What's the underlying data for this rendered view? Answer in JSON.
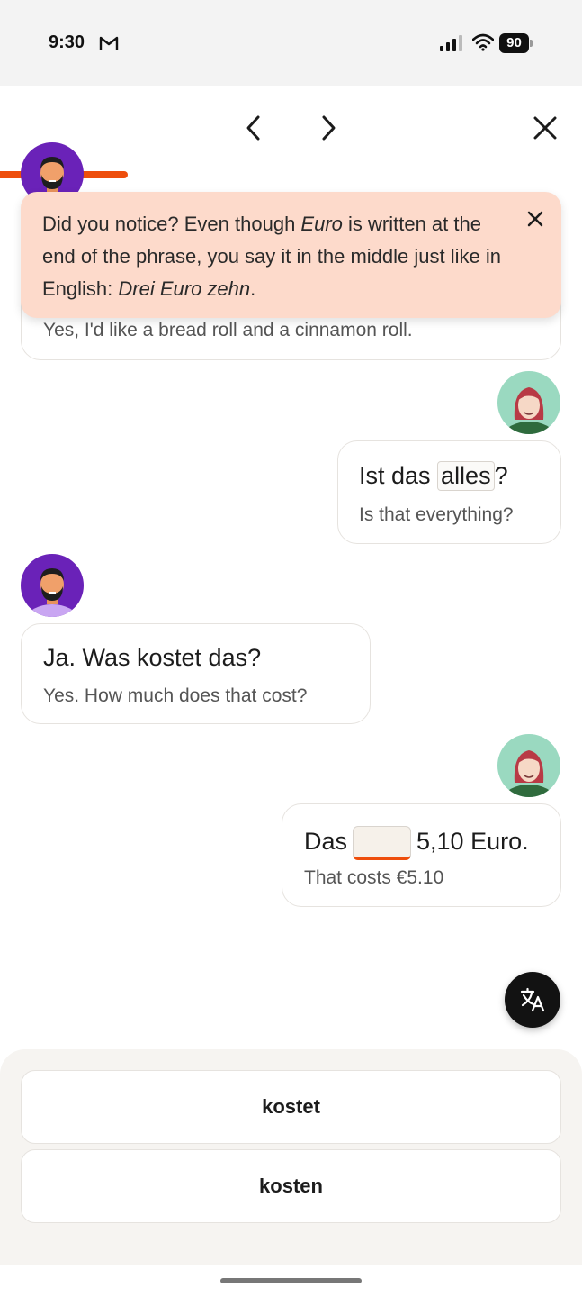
{
  "status_bar": {
    "time": "9:30",
    "battery": "90",
    "icons": [
      "gmail-icon",
      "signal-icon",
      "wifi-icon",
      "battery-icon"
    ]
  },
  "nav": {
    "icons": [
      "chevron-left-icon",
      "chevron-right-icon",
      "close-icon"
    ]
  },
  "progress": {
    "fraction": 0.22,
    "color": "#ee4e0c"
  },
  "tip": {
    "part1": "Did you notice? Even though ",
    "em1": "Euro",
    "part2": " is written at the end of the phrase, you say it in the middle just like in English: ",
    "em2": "Drei Euro zehn",
    "part3": "."
  },
  "messages": [
    {
      "speaker": "male",
      "translation": "Yes, I'd like a bread roll and a cinnamon roll."
    },
    {
      "speaker": "female",
      "before": "Ist das ",
      "highlight": "alles",
      "after": "?",
      "translation": "Is that everything?"
    },
    {
      "speaker": "male",
      "text": "Ja. Was kostet das?",
      "translation": "Yes. How much does that cost?"
    },
    {
      "speaker": "female",
      "before": "Das",
      "after": "5,10 Euro.",
      "translation": "That costs €5.10"
    }
  ],
  "options": [
    "kostet",
    "kosten"
  ],
  "colors": {
    "accent": "#ee4e0c",
    "tip_bg": "#fddacb",
    "male_avatar_bg": "#6a22b8",
    "female_avatar_bg": "#9ad9c0"
  },
  "fab_icon": "translate-icon"
}
